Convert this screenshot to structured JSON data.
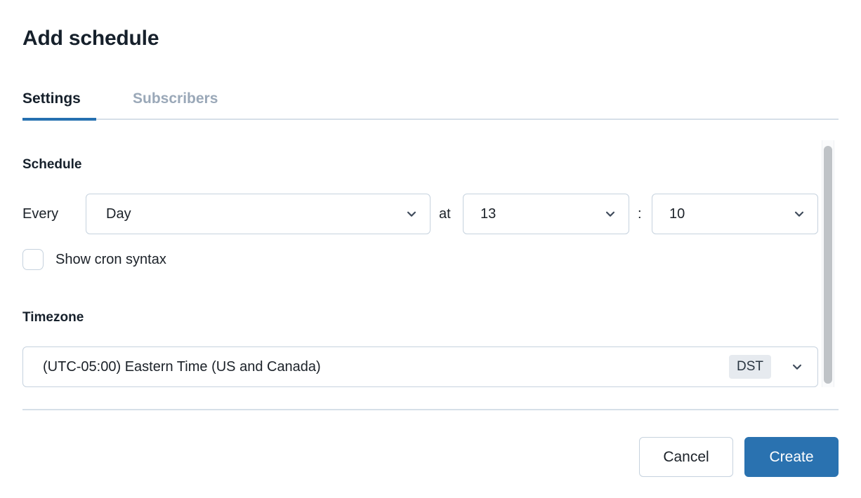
{
  "dialog": {
    "title": "Add schedule"
  },
  "tabs": [
    {
      "label": "Settings",
      "active": true
    },
    {
      "label": "Subscribers",
      "active": false
    }
  ],
  "schedule": {
    "section_label": "Schedule",
    "every_label": "Every",
    "at_label": "at",
    "colon_label": ":",
    "frequency": {
      "value": "Day",
      "icon": "chevron-down-icon"
    },
    "hour": {
      "value": "13",
      "icon": "chevron-down-icon"
    },
    "minute": {
      "value": "10",
      "icon": "chevron-down-icon"
    },
    "cron_checkbox": {
      "label": "Show cron syntax",
      "checked": false
    }
  },
  "timezone": {
    "section_label": "Timezone",
    "value": "(UTC-05:00) Eastern Time (US and Canada)",
    "badge": "DST",
    "icon": "chevron-down-icon"
  },
  "footer": {
    "cancel_label": "Cancel",
    "create_label": "Create"
  },
  "colors": {
    "accent": "#2570b0",
    "primary_button": "#2a72b0",
    "border": "#c6d2de",
    "muted_text": "#9aa8b8",
    "badge_bg": "#e6eaef",
    "scrollbar_thumb": "#bfc3c7"
  }
}
